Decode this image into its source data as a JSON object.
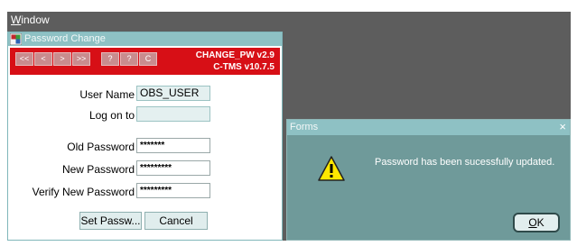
{
  "menu": {
    "window_label_mnemonic": "W",
    "window_label_rest": "indow"
  },
  "pw_window": {
    "title": "Password Change",
    "toolbar_buttons": [
      "<<",
      "<",
      ">",
      ">>",
      "?",
      "?",
      "C"
    ],
    "version_line1": "CHANGE_PW v2.9",
    "version_line2": "C-TMS v10.7.5"
  },
  "form": {
    "user_name_label": "User Name",
    "user_name_value": "OBS_USER",
    "log_on_to_label": "Log on to",
    "log_on_to_value": "",
    "old_password_label": "Old Password",
    "old_password_value": "*******",
    "new_password_label": "New Password",
    "new_password_value": "*********",
    "verify_password_label": "Verify New Password",
    "verify_password_value": "*********",
    "set_password_button": "Set Passw...",
    "cancel_button": "Cancel"
  },
  "dialog": {
    "title": "Forms",
    "close_glyph": "×",
    "message": "Password has been sucessfully updated.",
    "ok_mnemonic": "O",
    "ok_rest": "K"
  }
}
